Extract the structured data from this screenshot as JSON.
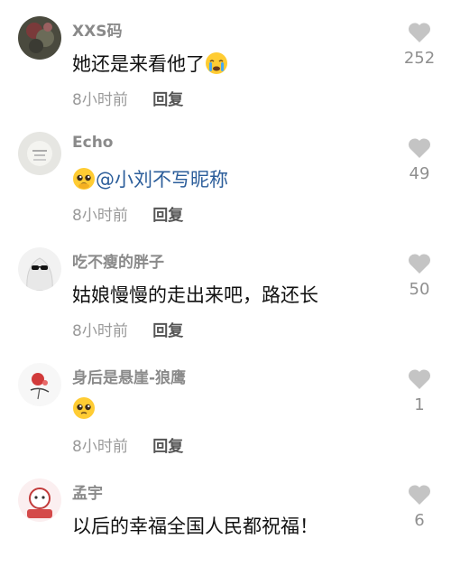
{
  "comments": [
    {
      "username": "XXS码",
      "text": "她还是来看他了",
      "emoji": "crying-face-emoji",
      "mention": "",
      "time": "8小时前",
      "reply": "回复",
      "likes": "252"
    },
    {
      "username": "Echo",
      "text": "",
      "emoji": "pleading-face-emoji",
      "mention": "@小刘不写昵称",
      "time": "8小时前",
      "reply": "回复",
      "likes": "49"
    },
    {
      "username": "吃不瘦的胖子",
      "text": "姑娘慢慢的走出来吧，路还长",
      "emoji": "",
      "mention": "",
      "time": "8小时前",
      "reply": "回复",
      "likes": "50"
    },
    {
      "username": "身后是悬崖-狼鹰",
      "text": "",
      "emoji": "pleading-face-emoji",
      "mention": "",
      "time": "8小时前",
      "reply": "回复",
      "likes": "1"
    },
    {
      "username": "孟宇",
      "text": "以后的幸福全国人民都祝福！",
      "emoji": "",
      "mention": "",
      "time": "",
      "reply": "",
      "likes": "6"
    }
  ],
  "colors": {
    "like_icon": "#c4c4c4",
    "mention": "#2b5d9a",
    "username": "#8a8a8a"
  }
}
